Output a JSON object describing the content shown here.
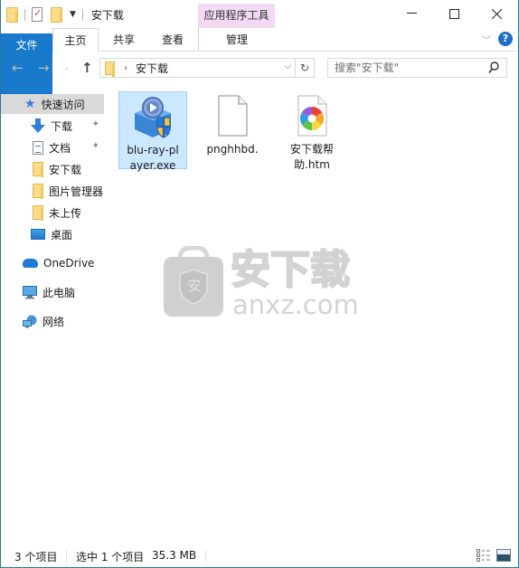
{
  "window": {
    "title": "安下载",
    "quick_access_toolbar": [
      "folder-icon",
      "properties-icon",
      "new-folder-icon",
      "customize-dropdown"
    ],
    "controls": {
      "minimize": "—",
      "maximize": "☐",
      "close": "✕"
    }
  },
  "ribbon": {
    "contextual_header": "应用程序工具",
    "tabs": [
      {
        "label": "文件",
        "active_style": "file-blue"
      },
      {
        "label": "主页",
        "selected": true
      },
      {
        "label": "共享"
      },
      {
        "label": "查看"
      },
      {
        "label": "管理",
        "contextual": true
      }
    ],
    "expand_icon": "chevron-down",
    "help_label": "?"
  },
  "navigation": {
    "back": "←",
    "forward": "→",
    "recent": "⌄",
    "up": "↑",
    "address": {
      "breadcrumb": [
        "安下载"
      ],
      "separator": "›"
    },
    "refresh": "↻",
    "search": {
      "placeholder": "搜索\"安下载\"",
      "value": ""
    }
  },
  "sidebar": {
    "items": [
      {
        "label": "快速访问",
        "icon": "star-icon",
        "selected": true
      },
      {
        "label": "下载",
        "icon": "download-icon",
        "pinned": true
      },
      {
        "label": "文档",
        "icon": "document-icon",
        "pinned": true
      },
      {
        "label": "安下载",
        "icon": "folder-icon"
      },
      {
        "label": "图片管理器",
        "icon": "folder-icon"
      },
      {
        "label": "未上传",
        "icon": "folder-icon"
      },
      {
        "label": "桌面",
        "icon": "desktop-icon"
      },
      {
        "label": "OneDrive",
        "icon": "cloud-icon"
      },
      {
        "label": "此电脑",
        "icon": "computer-icon"
      },
      {
        "label": "网络",
        "icon": "network-icon"
      }
    ],
    "pin_glyph": "📌"
  },
  "files": [
    {
      "name": "blu-ray-player.exe",
      "display": [
        "blu-ray-pl",
        "ayer.exe"
      ],
      "icon": "installer-icon",
      "selected": true
    },
    {
      "name": "pnghhbd.",
      "display": [
        "pnghhbd."
      ],
      "icon": "blank-file-icon",
      "selected": false
    },
    {
      "name": "安下载帮助.htm",
      "display": [
        "安下载帮",
        "助.htm"
      ],
      "icon": "htm-file-icon",
      "selected": false
    }
  ],
  "watermark": {
    "title": "安下载",
    "subtitle": "anxz.com",
    "badge": "安"
  },
  "status": {
    "item_count": "3 个项目",
    "selection": "选中 1 个项目",
    "size": "35.3 MB"
  },
  "colors": {
    "file_tab": "#1979ca",
    "contextual_tab": "#f2d9f4",
    "selection_fill": "#cce8ff",
    "selection_border": "#99d1ff",
    "window_border": "#2b7a9e"
  }
}
